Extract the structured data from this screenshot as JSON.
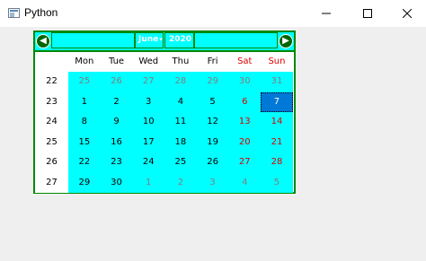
{
  "window": {
    "title": "Python",
    "minimize_label": "—",
    "maximize_label": "☐",
    "close_label": "✕"
  },
  "calendar": {
    "month_label": "June",
    "year_label": "2020",
    "prev_label": "◀",
    "next_label": "▶",
    "headers": [
      "Mon",
      "Tue",
      "Wed",
      "Thu",
      "Fri",
      "Sat",
      "Sun"
    ],
    "weeks": [
      {
        "number": "22",
        "days": [
          "25",
          "26",
          "27",
          "28",
          "29",
          "30",
          "31"
        ]
      },
      {
        "number": "23",
        "days": [
          "1",
          "2",
          "3",
          "4",
          "5",
          "6",
          "7"
        ]
      },
      {
        "number": "24",
        "days": [
          "8",
          "9",
          "10",
          "11",
          "12",
          "13",
          "14"
        ]
      },
      {
        "number": "25",
        "days": [
          "15",
          "16",
          "17",
          "18",
          "19",
          "20",
          "21"
        ]
      },
      {
        "number": "26",
        "days": [
          "22",
          "23",
          "24",
          "25",
          "26",
          "27",
          "28"
        ]
      },
      {
        "number": "27",
        "days": [
          "29",
          "30",
          "1",
          "2",
          "3",
          "4",
          "5"
        ]
      }
    ],
    "selected": "7",
    "colors": {
      "background": "#00ffff",
      "border": "#008800",
      "weekend": "#dd0000",
      "other_month": "#808080",
      "selected": "#0078d7"
    }
  }
}
